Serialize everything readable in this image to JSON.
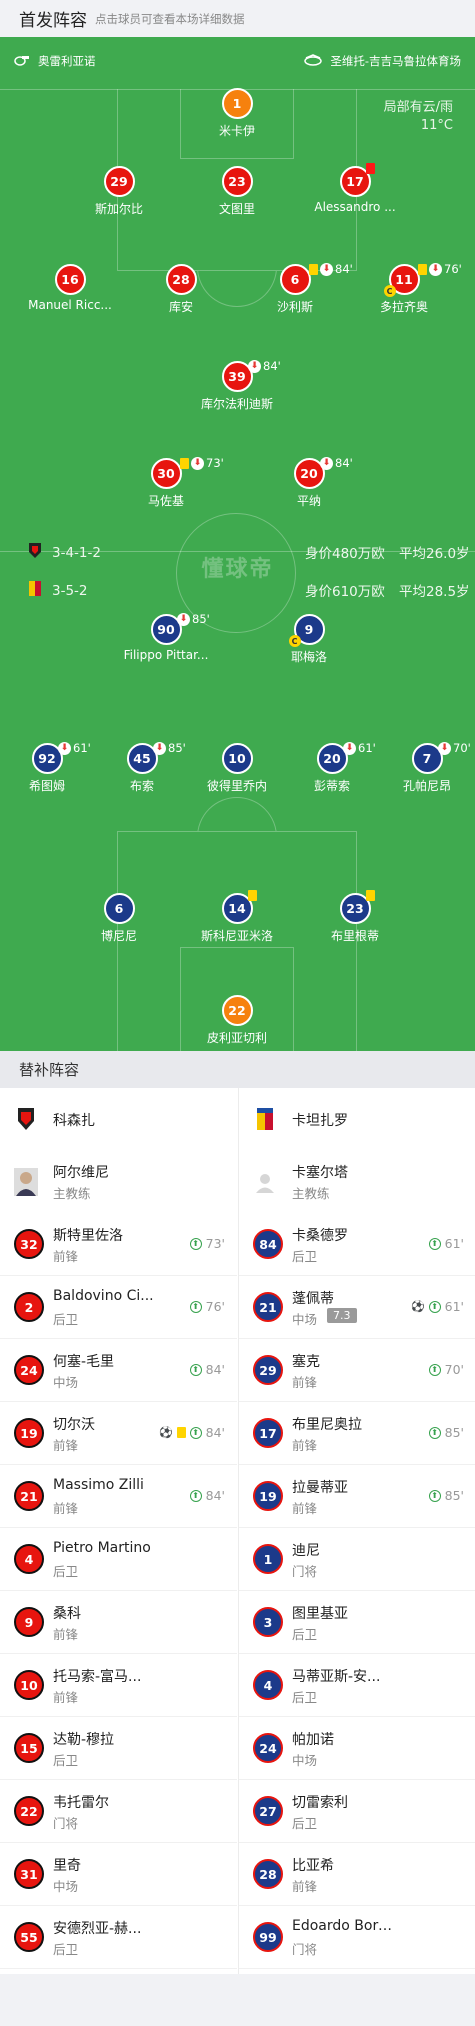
{
  "header": {
    "title": "首发阵容",
    "subtitle": "点击球员可查看本场详细数据"
  },
  "match_info": {
    "referee": "奥雷利亚诺",
    "stadium": "圣维托-吉吉马鲁拉体育场",
    "weather": "局部有云/雨",
    "temperature": "11°C"
  },
  "colors": {
    "pitch": "#3faa4f",
    "home": "#e7150f",
    "away": "#1c3a8a",
    "gk_home": "#f6810e"
  },
  "home": {
    "formation": "3-4-1-2",
    "value": "身价480万欧",
    "age": "平均26.0岁",
    "players": [
      {
        "num": "1",
        "name": "米卡伊"
      },
      {
        "num": "29",
        "name": "斯加尔比"
      },
      {
        "num": "23",
        "name": "文图里"
      },
      {
        "num": "17",
        "name": "Alessandro ...",
        "ev": {
          "red": true
        }
      },
      {
        "num": "16",
        "name": "Manuel Ricc..."
      },
      {
        "num": "28",
        "name": "库安"
      },
      {
        "num": "6",
        "name": "沙利斯",
        "ev": {
          "yellow": true,
          "sub": true,
          "min": "84'"
        }
      },
      {
        "num": "11",
        "name": "多拉齐奥",
        "captain": "C",
        "ev": {
          "yellow": true,
          "sub": true,
          "min": "76'"
        }
      },
      {
        "num": "39",
        "name": "库尔法利迪斯",
        "ev": {
          "sub": true,
          "min": "84'"
        }
      },
      {
        "num": "30",
        "name": "马佐基",
        "ev": {
          "yellow": true,
          "sub": true,
          "min": "73'"
        }
      },
      {
        "num": "20",
        "name": "平纳",
        "ev": {
          "sub": true,
          "min": "84'"
        }
      }
    ]
  },
  "away": {
    "formation": "3-5-2",
    "value": "身价610万欧",
    "age": "平均28.5岁",
    "players": [
      {
        "num": "90",
        "name": "Filippo Pittar...",
        "ev": {
          "sub": true,
          "min": "85'"
        }
      },
      {
        "num": "9",
        "name": "耶梅洛",
        "captain": "C"
      },
      {
        "num": "92",
        "name": "希图姆",
        "ev": {
          "sub": true,
          "min": "61'"
        }
      },
      {
        "num": "45",
        "name": "布索",
        "ev": {
          "sub": true,
          "min": "85'"
        }
      },
      {
        "num": "10",
        "name": "彼得里乔内"
      },
      {
        "num": "20",
        "name": "彭蒂索",
        "ev": {
          "sub": true,
          "min": "61'"
        }
      },
      {
        "num": "7",
        "name": "孔帕尼昂",
        "ev": {
          "sub": true,
          "min": "70'"
        }
      },
      {
        "num": "6",
        "name": "博尼尼"
      },
      {
        "num": "14",
        "name": "斯科尼亚米洛",
        "ev": {
          "yellow": true
        }
      },
      {
        "num": "23",
        "name": "布里根蒂",
        "ev": {
          "yellow": true
        }
      },
      {
        "num": "22",
        "name": "皮利亚切利"
      }
    ]
  },
  "watermark": "懂球帝",
  "subs": {
    "title": "替补阵容",
    "home": {
      "team": "科森扎",
      "coach_name": "阿尔维尼",
      "coach_label": "主教练",
      "list": [
        {
          "num": "32",
          "name": "斯特里佐洛",
          "pos": "前锋",
          "min": "73'"
        },
        {
          "num": "2",
          "name": "Baldovino Ci...",
          "pos": "后卫",
          "min": "76'"
        },
        {
          "num": "24",
          "name": "何塞-毛里",
          "pos": "中场",
          "min": "84'"
        },
        {
          "num": "19",
          "name": "切尔沃",
          "pos": "前锋",
          "min": "84'",
          "goal": true,
          "yellow": true
        },
        {
          "num": "21",
          "name": "Massimo Zilli",
          "pos": "前锋",
          "min": "84'"
        },
        {
          "num": "4",
          "name": "Pietro Martino",
          "pos": "后卫"
        },
        {
          "num": "9",
          "name": "桑科",
          "pos": "前锋"
        },
        {
          "num": "10",
          "name": "托马索-富马...",
          "pos": "前锋"
        },
        {
          "num": "15",
          "name": "达勒-穆拉",
          "pos": "后卫"
        },
        {
          "num": "22",
          "name": "韦托雷尔",
          "pos": "门将"
        },
        {
          "num": "31",
          "name": "里奇",
          "pos": "中场"
        },
        {
          "num": "55",
          "name": "安德烈亚-赫...",
          "pos": "后卫"
        }
      ]
    },
    "away": {
      "team": "卡坦扎罗",
      "coach_name": "卡塞尔塔",
      "coach_label": "主教练",
      "list": [
        {
          "num": "84",
          "name": "卡桑德罗",
          "pos": "后卫",
          "min": "61'"
        },
        {
          "num": "21",
          "name": "蓬佩蒂",
          "pos": "中场",
          "rating": "7.3",
          "min": "61'",
          "goal": true
        },
        {
          "num": "29",
          "name": "塞克",
          "pos": "前锋",
          "min": "70'"
        },
        {
          "num": "17",
          "name": "布里尼奥拉",
          "pos": "前锋",
          "min": "85'"
        },
        {
          "num": "19",
          "name": "拉曼蒂亚",
          "pos": "前锋",
          "min": "85'"
        },
        {
          "num": "1",
          "name": "迪尼",
          "pos": "门将"
        },
        {
          "num": "3",
          "name": "图里基亚",
          "pos": "后卫"
        },
        {
          "num": "4",
          "name": "马蒂亚斯-安...",
          "pos": "后卫"
        },
        {
          "num": "24",
          "name": "帕加诺",
          "pos": "中场"
        },
        {
          "num": "27",
          "name": "切雷索利",
          "pos": "后卫"
        },
        {
          "num": "28",
          "name": "比亚希",
          "pos": "前锋"
        },
        {
          "num": "99",
          "name": "Edoardo Borrelli",
          "pos": "门将"
        }
      ]
    }
  }
}
